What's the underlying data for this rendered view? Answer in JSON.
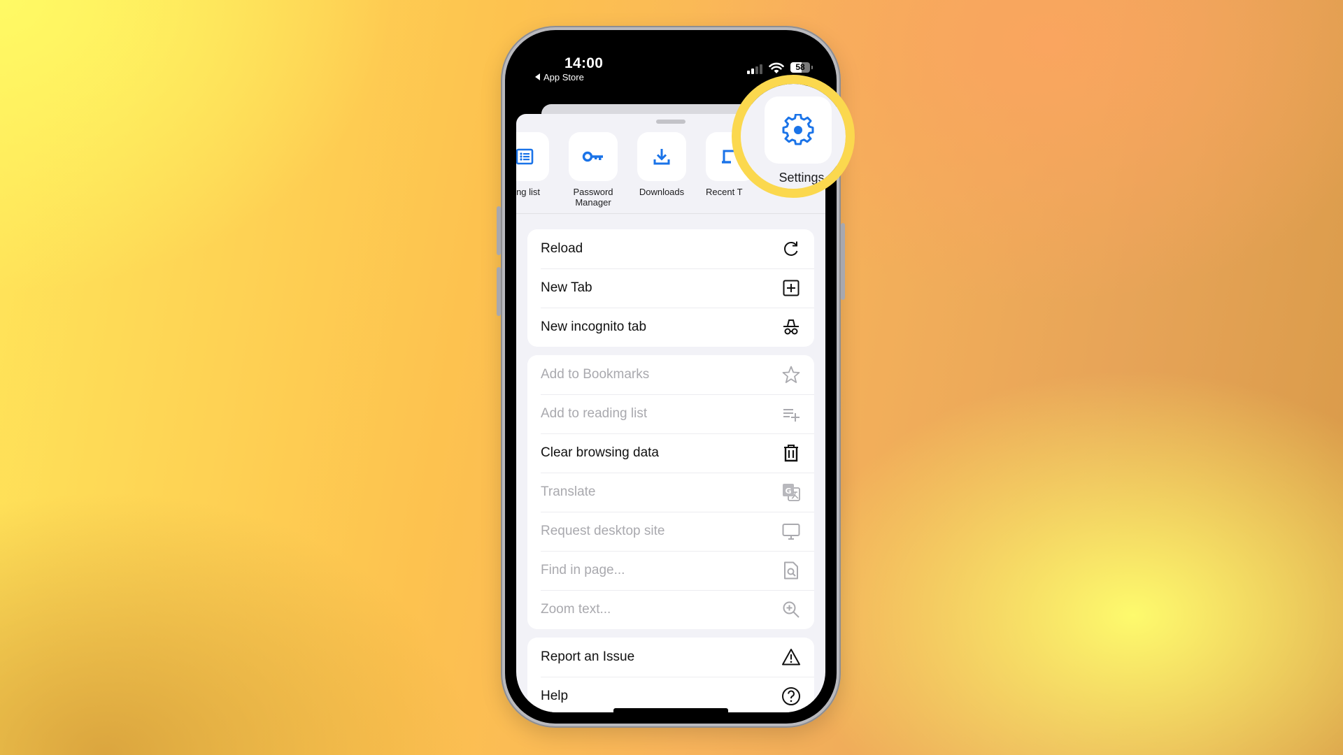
{
  "status_bar": {
    "time": "14:00",
    "back_app": "App Store",
    "battery": "58"
  },
  "colors": {
    "accent_blue": "#1a73e8",
    "highlight_ring": "#fbd84e",
    "disabled_text": "#a9a9ae"
  },
  "shortcuts": [
    {
      "label": "ding list",
      "icon": "reading-list-icon"
    },
    {
      "label": "Password Manager",
      "icon": "key-icon"
    },
    {
      "label": "Downloads",
      "icon": "download-icon"
    },
    {
      "label": "Recent T",
      "icon": "recent-tabs-icon"
    },
    {
      "label": "Settings",
      "icon": "gear-icon",
      "highlighted": true
    }
  ],
  "menu_groups": [
    {
      "items": [
        {
          "label": "Reload",
          "icon": "reload-icon",
          "enabled": true
        },
        {
          "label": "New Tab",
          "icon": "plus-square-icon",
          "enabled": true
        },
        {
          "label": "New incognito tab",
          "icon": "incognito-icon",
          "enabled": true
        }
      ]
    },
    {
      "items": [
        {
          "label": "Add to Bookmarks",
          "icon": "star-icon",
          "enabled": false
        },
        {
          "label": "Add to reading list",
          "icon": "add-list-icon",
          "enabled": false
        },
        {
          "label": "Clear browsing data",
          "icon": "trash-icon",
          "enabled": true
        },
        {
          "label": "Translate",
          "icon": "translate-icon",
          "enabled": false
        },
        {
          "label": "Request desktop site",
          "icon": "monitor-icon",
          "enabled": false
        },
        {
          "label": "Find in page...",
          "icon": "find-in-page-icon",
          "enabled": false
        },
        {
          "label": "Zoom text...",
          "icon": "zoom-in-icon",
          "enabled": false
        }
      ]
    },
    {
      "items": [
        {
          "label": "Report an Issue",
          "icon": "warning-icon",
          "enabled": true
        },
        {
          "label": "Help",
          "icon": "help-icon",
          "enabled": true
        }
      ]
    }
  ]
}
